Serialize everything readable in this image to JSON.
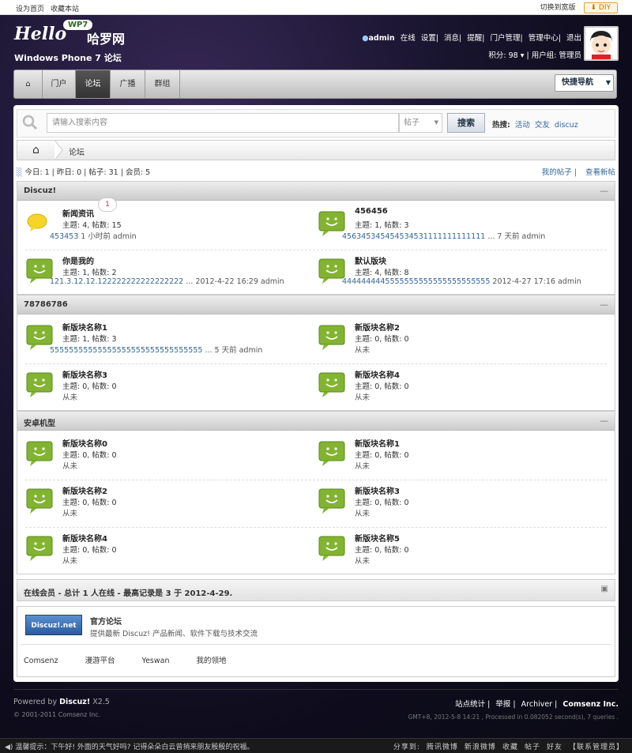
{
  "topbar": {
    "set_home": "设为首页",
    "bookmark": "收藏本站",
    "switch_wide": "切换到宽版",
    "diy": "DIY"
  },
  "logo": {
    "hello": "Hello",
    "wp7": "WP7",
    "brand": "哈罗网",
    "sub": "Windows Phone 7 论坛"
  },
  "user": {
    "name": "admin",
    "status": "在线",
    "links": [
      "设置",
      "消息",
      "提醒",
      "门户管理",
      "管理中心",
      "退出"
    ],
    "points_label": "积分: 98",
    "group_label": "用户组: 管理员"
  },
  "nav": {
    "items": [
      "门户",
      "论坛",
      "广播",
      "群组"
    ],
    "quick": "快捷导航"
  },
  "search": {
    "placeholder": "请输入搜索内容",
    "type": "帖子",
    "button": "搜索",
    "hot_label": "热搜:",
    "hot": [
      "活动",
      "交友",
      "discuz"
    ]
  },
  "crumb": {
    "title": "论坛"
  },
  "stats": {
    "today": "今日: 1",
    "yesterday": "昨日: 0",
    "posts": "帖子: 31",
    "members": "会员: 5",
    "my_posts": "我的帖子",
    "new_posts": "查看新帖"
  },
  "groups": [
    {
      "title": "Discuz!",
      "forums": [
        {
          "name": "新闻资讯",
          "stats": "主题: 4, 帖数: 15",
          "last_link": "453453",
          "last_rest": " 1 小时前 admin",
          "badge": "1"
        },
        {
          "name": "456456",
          "stats": "主题: 1, 帖数: 3",
          "last_link": "456345345454534531111111111111",
          "last_rest": " ... 7 天前 admin"
        },
        {
          "name": "你是我的",
          "stats": "主题: 1, 帖数: 2",
          "last_link": "121.3.12.12.122222222222222222",
          "last_rest": " ... 2012-4-22 16:29 admin"
        },
        {
          "name": "默认版块",
          "stats": "主题: 4, 帖数: 8",
          "last_link": "4444444445555555555555555555555",
          "last_rest": " 2012-4-27 17:16 admin"
        }
      ]
    },
    {
      "title": "78786786",
      "forums": [
        {
          "name": "新版块名称1",
          "stats": "主题: 1, 帖数: 3",
          "last_link": "55555555555555555555555555555555",
          "last_rest": " ... 5 天前 admin"
        },
        {
          "name": "新版块名称2",
          "stats": "主题: 0, 帖数: 0",
          "last_rest": "从未"
        },
        {
          "name": "新版块名称3",
          "stats": "主题: 0, 帖数: 0",
          "last_rest": "从未"
        },
        {
          "name": "新版块名称4",
          "stats": "主题: 0, 帖数: 0",
          "last_rest": "从未"
        }
      ]
    },
    {
      "title": "安卓机型",
      "forums": [
        {
          "name": "新版块名称0",
          "stats": "主题: 0, 帖数: 0",
          "last_rest": "从未"
        },
        {
          "name": "新版块名称1",
          "stats": "主题: 0, 帖数: 0",
          "last_rest": "从未"
        },
        {
          "name": "新版块名称2",
          "stats": "主题: 0, 帖数: 0",
          "last_rest": "从未"
        },
        {
          "name": "新版块名称3",
          "stats": "主题: 0, 帖数: 0",
          "last_rest": "从未"
        },
        {
          "name": "新版块名称4",
          "stats": "主题: 0, 帖数: 0",
          "last_rest": "从未"
        },
        {
          "name": "新版块名称5",
          "stats": "主题: 0, 帖数: 0",
          "last_rest": "从未"
        }
      ]
    }
  ],
  "online": {
    "title": "在线会员 - 总计 1 人在线 - 最高记录是 3 于 2012-4-29."
  },
  "links": {
    "logo_text": "Discuz!.net",
    "name": "官方论坛",
    "desc": "提供最新 Discuz! 产品新闻、软件下载与技术交流",
    "friends": [
      "Comsenz",
      "漫游平台",
      "Yeswan",
      "我的领地"
    ]
  },
  "footer": {
    "powered": "Powered by",
    "product": "Discuz!",
    "version": "X2.5",
    "copyright": "© 2001-2011 Comsenz Inc.",
    "links": [
      "站点统计",
      "举报",
      "Archiver"
    ],
    "company": "Comsenz Inc.",
    "gmt": "GMT+8, 2012-5-8 14:21 , Processed in 0.082052 second(s), 7 queries ."
  },
  "bottombar": {
    "tip": "温馨提示：下午好! 外面的天气好吗? 记得朵朵白云曾捎来朋友殷殷的祝福。",
    "share_label": "分享到:",
    "share": [
      "腾讯微博",
      "新浪微博",
      "收藏",
      "帖子",
      "好友"
    ],
    "contact": "【联系管理员】"
  },
  "colors": {
    "link": "#336699",
    "nav_active": "#333333",
    "icon_green": "#7ab02c",
    "icon_yellow": "#f5d020"
  }
}
